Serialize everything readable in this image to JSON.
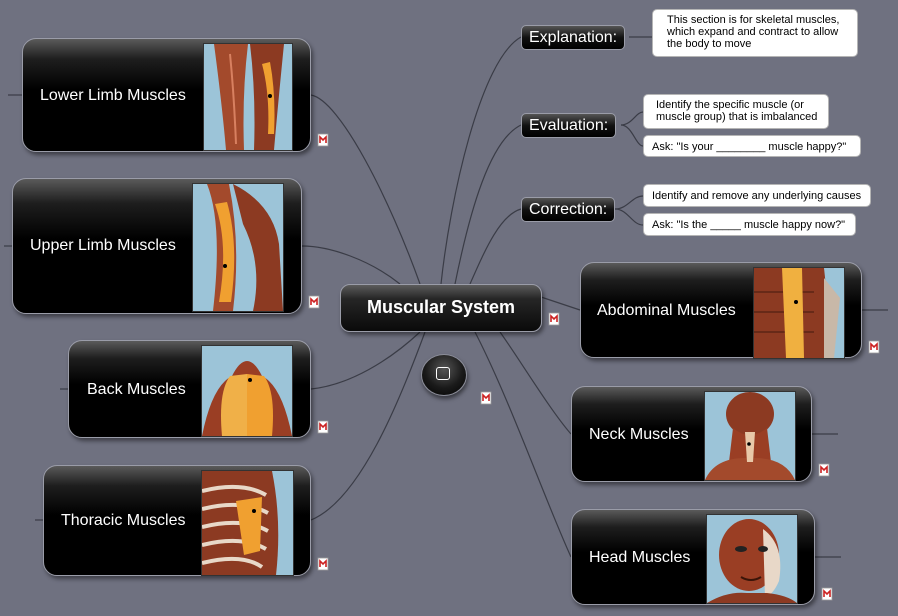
{
  "central": {
    "title": "Muscular System"
  },
  "subtopics": {
    "explanation": {
      "label": "Explanation:",
      "notes": [
        "This section is for skeletal muscles, which expand and contract to allow the body to move"
      ]
    },
    "evaluation": {
      "label": "Evaluation:",
      "notes": [
        "Identify the specific muscle (or muscle group) that is imbalanced",
        "Ask: \"Is your ________ muscle happy?\""
      ]
    },
    "correction": {
      "label": "Correction:",
      "notes": [
        "Identify and remove any underlying causes",
        "Ask: \"Is the _____ muscle happy now?\""
      ]
    }
  },
  "branches": {
    "lower_limb": "Lower Limb Muscles",
    "upper_limb": "Upper Limb Muscles",
    "back": "Back Muscles",
    "thoracic": "Thoracic Muscles",
    "abdominal": "Abdominal Muscles",
    "neck": "Neck Muscles",
    "head": "Head Muscles"
  },
  "icons": {
    "note_marker": "mindmap-note-icon",
    "collapse_toggle": "collapse-toggle-icon"
  },
  "colors": {
    "canvas": "#6f7180",
    "node": "#000000",
    "highlight_muscle": "#f0a030",
    "note_marker": "#cc2222"
  }
}
